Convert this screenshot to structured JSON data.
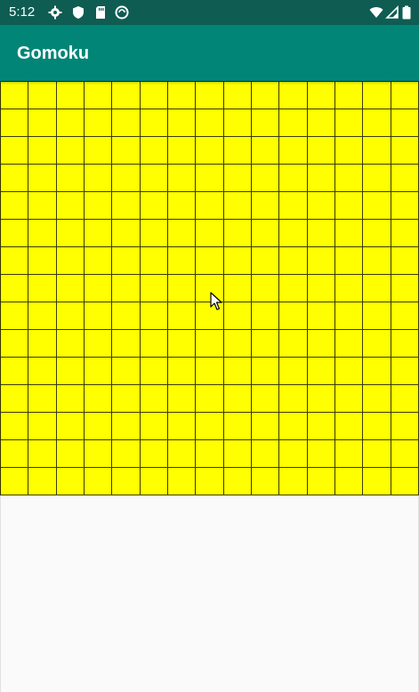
{
  "status_bar": {
    "time": "5:12",
    "left_icons": [
      "gear-icon",
      "shield-icon",
      "sd-card-icon",
      "sync-icon"
    ],
    "right_icons": [
      "wifi-icon",
      "signal-icon",
      "battery-icon"
    ]
  },
  "app_bar": {
    "title": "Gomoku"
  },
  "board": {
    "columns": 15,
    "rows": 15,
    "cell_color": "#ffff00",
    "line_color": "#3a3a00"
  },
  "colors": {
    "status_bar": "#0e5c52",
    "app_bar": "#008577",
    "background": "#fafafa"
  }
}
